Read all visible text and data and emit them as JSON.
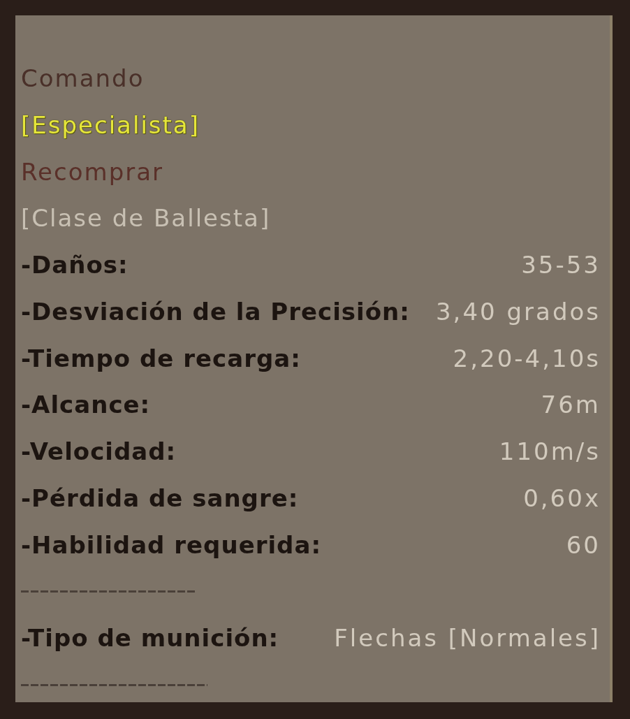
{
  "tooltip": {
    "title": "Comando",
    "rank": "[Especialista]",
    "action": "Recomprar",
    "class": "[Clase de Ballesta]",
    "stats": [
      {
        "label": "-Daños:",
        "value": "35-53"
      },
      {
        "label": "-Desviación de la Precisión:",
        "value": "3,40 grados"
      },
      {
        "label": "-Tiempo de recarga:",
        "value": "2,20-4,10s"
      },
      {
        "label": "-Alcance:",
        "value": "76m"
      },
      {
        "label": "-Velocidad:",
        "value": "110m/s"
      },
      {
        "label": "-Pérdida de sangre:",
        "value": "0,60x"
      },
      {
        "label": "-Habilidad requerida:",
        "value": "60"
      }
    ],
    "ammo": {
      "label": "-Tipo de munición:",
      "value": "Flechas [Normales]"
    }
  }
}
